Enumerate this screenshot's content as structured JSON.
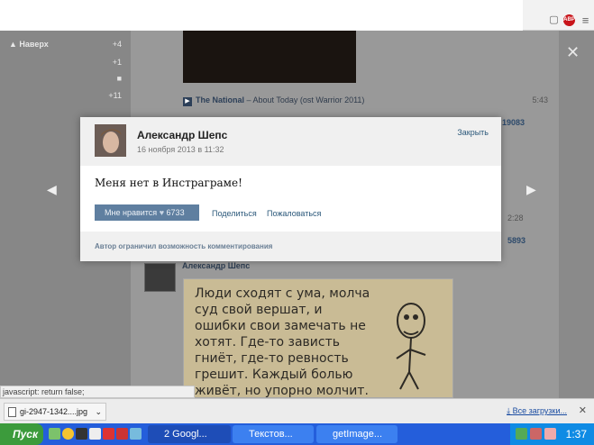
{
  "left_panel": {
    "up_label": "Наверх",
    "counters": [
      "+4",
      "+1",
      "+11"
    ]
  },
  "feed": {
    "music_artist": "The National",
    "music_title": " – About Today (ost Warrior 2011)",
    "music_time": "5:43",
    "side_numbers": [
      "19083",
      "2:28",
      "5893"
    ],
    "post_author": "Александр Шепс",
    "meme_text": "Люди сходят с ума, молча суд свой вершат, и ошибки свои замечать не хотят. Где-то зависть гниёт, где-то ревность грешит. Каждый болью живёт, но упорно молчит. (с) А. Шепс"
  },
  "modal": {
    "author": "Александр Шепс",
    "date": "16 ноября 2013 в 11:32",
    "close_label": "Закрыть",
    "text": "Меня нет в Инстраграме!",
    "like_label": "Мне нравится",
    "like_count": "6733",
    "share_label": "Поделиться",
    "report_label": "Пожаловаться",
    "comment_note": "Автор ограничил возможность комментирования"
  },
  "status_text": "javascript: return false;",
  "downloads": {
    "file_name": "gi-2947-1342....jpg",
    "all_label": "Все загрузки..."
  },
  "taskbar": {
    "start_label": "Пуск",
    "tasks": [
      "2 Googl...",
      "Текстов...",
      "getImage..."
    ],
    "clock": "1:37"
  }
}
